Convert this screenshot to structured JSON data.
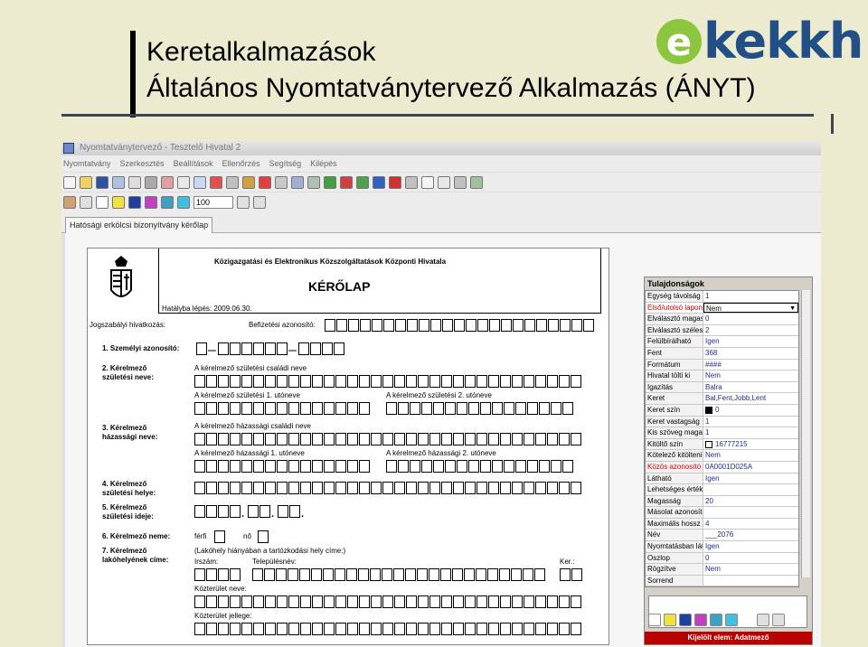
{
  "slide": {
    "title_line1": "Keretalkalmazások",
    "title_line2": "Általános Nyomtatványtervező Alkalmazás (ÁNYT)",
    "logo_e": "e",
    "logo_text": "kekkh"
  },
  "app": {
    "window_title": "Nyomtatványtervező - Tesztelő Hivatal 2",
    "menu": [
      "Nyomtatvány",
      "Szerkesztés",
      "Beállítások",
      "Ellenőrzés",
      "Segítség",
      "Kilépés"
    ],
    "zoom": "100",
    "tab": "Hatósági erkölcsi bizonyítvány kérőlap"
  },
  "form": {
    "org": "Közigazgatási és Elektronikus Közszolgáltatások Központi Hivatala",
    "title": "KÉRŐLAP",
    "effective": "Hatályba lépés: 2009.06.30.",
    "legal_ref": "Jogszabályi hivatkozás:",
    "filing_id": "Befizetési azonosító:",
    "s1": "1. Személyi azonosító:",
    "s2a": "2. Kérelmező",
    "s2b": "születési neve:",
    "s2_family": "A kérelmező születési családi neve",
    "s2_first1": "A kérelmező születési 1. utóneve",
    "s2_first2": "A kérelmező születési 2. utóneve",
    "s3a": "3. Kérelmező",
    "s3b": "házassági neve:",
    "s3_family": "A kérelmező házassági családi neve",
    "s3_first1": "A kérelmező házassági 1. utóneve",
    "s3_first2": "A kérelmező házassági 2. utóneve",
    "s4a": "4. Kérelmező",
    "s4b": "születési helye:",
    "s5a": "5. Kérelmező",
    "s5b": "születési ideje:",
    "s6": "6. Kérelmező neme:",
    "male": "férfi",
    "female": "nő",
    "s7a": "7. Kérelmező",
    "s7b": "lakóhelyének címe:",
    "s7_note": "(Lakóhely hiányában a tartózkodási hely címe:)",
    "zip": "Irszám:",
    "city": "Településnév:",
    "district": "Ker.:",
    "street": "Közterület neve:",
    "street_type": "Közterület jellege:"
  },
  "properties": {
    "header": "Tulajdonságok",
    "rows": [
      {
        "name": "Egység távolság",
        "value": "1",
        "red": false
      },
      {
        "name": "Első/utolsó lapon",
        "value": "Nem",
        "red": true,
        "selected": true
      },
      {
        "name": "Elválasztó magasság",
        "value": "0",
        "red": false
      },
      {
        "name": "Elválasztó szélesség",
        "value": "2",
        "red": false
      },
      {
        "name": "Felülbírálható",
        "value": "Igen",
        "red": false
      },
      {
        "name": "Fent",
        "value": "368",
        "red": false
      },
      {
        "name": "Formátum",
        "value": "####",
        "red": false
      },
      {
        "name": "Hivatal tölti ki",
        "value": "Nem",
        "red": false
      },
      {
        "name": "Igazítás",
        "value": "Balra",
        "red": false
      },
      {
        "name": "Keret",
        "value": "Bal,Fent,Jobb,Lent",
        "red": false
      },
      {
        "name": "Keret szín",
        "value": "0",
        "red": false,
        "swatch": "#000000"
      },
      {
        "name": "Keret vastagság",
        "value": "1",
        "red": false
      },
      {
        "name": "Kis szöveg magasság",
        "value": "1",
        "red": false
      },
      {
        "name": "Kitöltő szín",
        "value": "16777215",
        "red": false,
        "swatch": "#ffffff"
      },
      {
        "name": "Kötelező kitölteni",
        "value": "Nem",
        "red": false
      },
      {
        "name": "Közös azonosító",
        "value": "0A0001D025A",
        "red": true
      },
      {
        "name": "Látható",
        "value": "Igen",
        "red": false
      },
      {
        "name": "Lehetséges értékek",
        "value": "",
        "red": false
      },
      {
        "name": "Magasság",
        "value": "20",
        "red": false
      },
      {
        "name": "Másolat azonosító",
        "value": "",
        "red": false
      },
      {
        "name": "Maximális hossz",
        "value": "4",
        "red": false
      },
      {
        "name": "Név",
        "value": "___2076",
        "red": false
      },
      {
        "name": "Nyomtatásban látszik",
        "value": "Igen",
        "red": false
      },
      {
        "name": "Oszlop",
        "value": "0",
        "red": false
      },
      {
        "name": "Rögzítve",
        "value": "Nem",
        "red": false
      },
      {
        "name": "Sorrend",
        "value": "",
        "red": false
      }
    ],
    "status": "Kijelölt elem: Adatmező"
  }
}
